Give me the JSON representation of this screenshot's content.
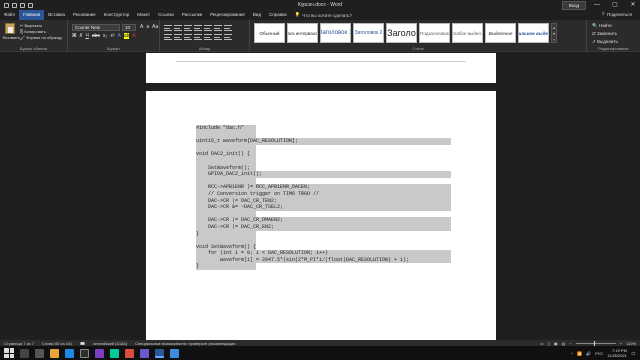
{
  "window": {
    "title": "Курсач.docx  -  Word",
    "signin_label": "Вход",
    "minimize": "—",
    "restore": "▢",
    "close": "✕"
  },
  "tabs": [
    {
      "label": "Файл"
    },
    {
      "label": "Главная",
      "active": true
    },
    {
      "label": "Вставка"
    },
    {
      "label": "Рисование"
    },
    {
      "label": "Конструктор"
    },
    {
      "label": "Макет"
    },
    {
      "label": "Ссылки"
    },
    {
      "label": "Рассылки"
    },
    {
      "label": "Рецензирование"
    },
    {
      "label": "Вид"
    },
    {
      "label": "Справка"
    }
  ],
  "tell_me": "Что вы хотите сделать?",
  "share_label": "Поделиться",
  "ribbon": {
    "clipboard": {
      "paste": "Вставить",
      "cut": "Вырезать",
      "copy": "Копировать",
      "format_painter": "Формат по образцу",
      "label": "Буфер обмена"
    },
    "font": {
      "name": "Courier New",
      "size": "10",
      "label": "Шрифт"
    },
    "paragraph": {
      "label": "Абзац"
    },
    "styles": {
      "label": "Стили",
      "items": [
        "Обычный",
        "Без интервала",
        "Заголовок 1",
        "Заголовок 2",
        "Заголо",
        "Подзаголовок",
        "Слабое выдел...",
        "Выделение",
        "Сильное выде..."
      ]
    },
    "editing": {
      "find": "Найти",
      "replace": "Заменить",
      "select": "Выделить",
      "label": "Редактирование"
    }
  },
  "code_lines": [
    "#include \"dac.h\"",
    "",
    "uint16_t waveform[DAC_RESOLUTION];",
    "",
    "void DAC2_init() {",
    "",
    "    SetWaveform();",
    "    GPIOA_DAC2_init();",
    "",
    "    RCC->APB1ENR |= RCC_APB1ENR_DACEN;",
    "    // Conversion trigger on TIM6 TRGO //",
    "    DAC->CR |= DAC_CR_TEN2;",
    "    DAC->CR &= ~DAC_CR_TSEL2;",
    "",
    "    DAC->CR |= DAC_CR_DMAEN2;",
    "    DAC->CR |= DAC_CR_EN2;",
    "}",
    "",
    "void SetWaveform() {",
    "    for (int i = 0; i < DAC_RESOLUTION; i++)",
    "        waveform[i] = 2047.5*(sin(2*M_PI*i/(float)DAC_RESOLUTION) + 1);",
    "}"
  ],
  "status": {
    "page": "Страница 7 из 7",
    "words": "Слово 50 из 441",
    "language": "английский (США)",
    "accessibility": "Специальные возможности: проверьте рекомендации",
    "zoom": "110%"
  },
  "taskbar": {
    "time": "7:19 PM",
    "date": "11/26/2021",
    "lang": "РУС"
  }
}
